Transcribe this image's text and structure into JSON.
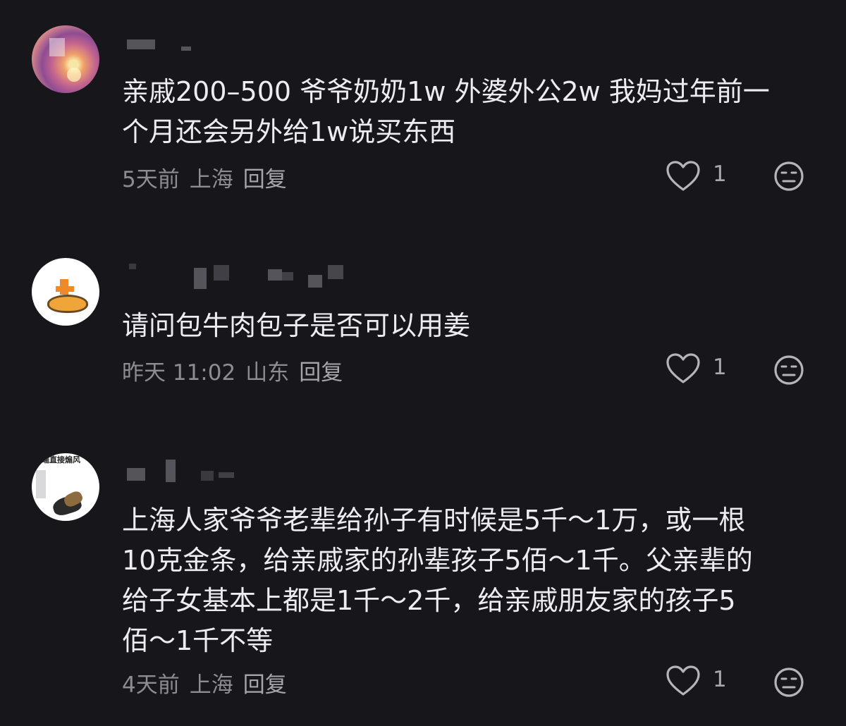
{
  "comments": [
    {
      "text": "亲戚200–500 爷爷奶奶1w 外婆外公2w 我妈过年前一\n个月还会另外给1w说买东西",
      "time": "5天前",
      "location": "上海",
      "reply_label": "回复",
      "likes": "1"
    },
    {
      "text": "请问包牛肉包子是否可以用姜",
      "time": "昨天 11:02",
      "location": "山东",
      "reply_label": "回复",
      "likes": "1"
    },
    {
      "avatar_text": "端直接煽风",
      "text": "上海人家爷爷老辈给孙子有时候是5千～1万，或一根\n10克金条，给亲戚家的孙辈孩子5佰～1千。父亲辈的\n给子女基本上都是1千～2千，给亲戚朋友家的孩子5\n佰～1千不等",
      "time": "4天前",
      "location": "上海",
      "reply_label": "回复",
      "likes": "1"
    }
  ],
  "icons": {
    "like": "heart-outline-icon",
    "dislike": "meh-face-icon"
  },
  "colors": {
    "background": "#17161b",
    "text": "#ededef",
    "meta": "#8d8c93"
  }
}
